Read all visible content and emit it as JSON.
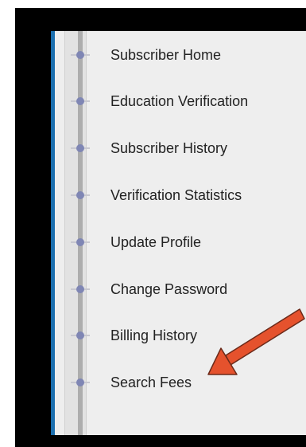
{
  "sidebar": {
    "items": [
      {
        "label": "Subscriber Home"
      },
      {
        "label": "Education Verification"
      },
      {
        "label": "Subscriber History"
      },
      {
        "label": "Verification Statistics"
      },
      {
        "label": "Update Profile"
      },
      {
        "label": "Change Password"
      },
      {
        "label": "Billing History"
      },
      {
        "label": "Search Fees"
      }
    ]
  },
  "annotation": {
    "arrow_color": "#e5522d",
    "target": "Search Fees"
  },
  "colors": {
    "accent": "#1b6faf",
    "dot": "#7f86b4",
    "panel": "#eeeeee",
    "frame": "#000000"
  }
}
